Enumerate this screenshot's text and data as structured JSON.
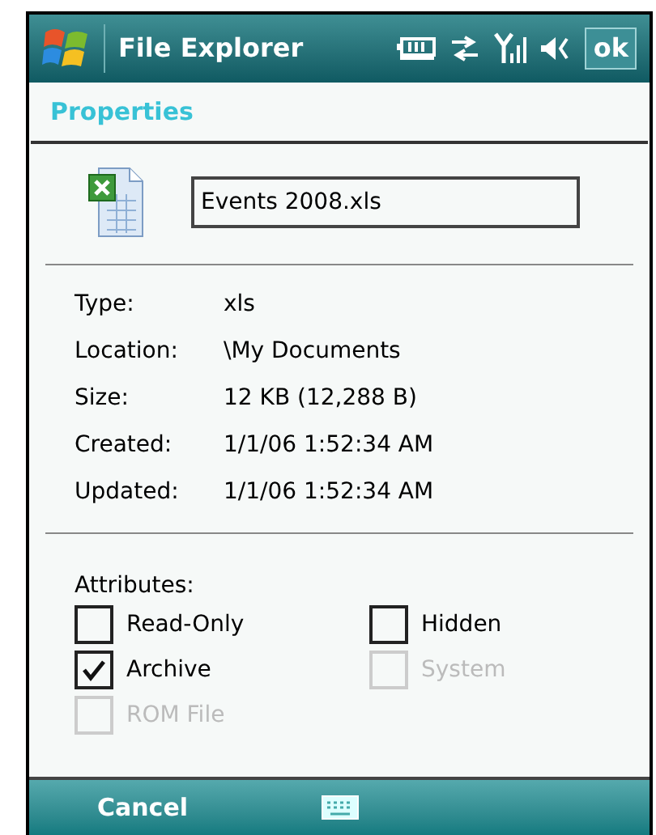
{
  "title_bar": {
    "title": "File Explorer",
    "ok": "ok"
  },
  "header": "Properties",
  "file_name": "Events 2008.xls",
  "details": [
    {
      "label": "Type:",
      "value": "xls"
    },
    {
      "label": "Location:",
      "value": "\\My Documents"
    },
    {
      "label": "Size:",
      "value": "12 KB (12,288 B)"
    },
    {
      "label": "Created:",
      "value": "1/1/06 1:52:34 AM"
    },
    {
      "label": "Updated:",
      "value": "1/1/06 1:52:34 AM"
    }
  ],
  "attributes_label": "Attributes:",
  "attributes": [
    {
      "label": "Read-Only",
      "checked": false,
      "disabled": false
    },
    {
      "label": "Hidden",
      "checked": false,
      "disabled": false
    },
    {
      "label": "Archive",
      "checked": true,
      "disabled": false
    },
    {
      "label": "System",
      "checked": false,
      "disabled": true
    },
    {
      "label": "ROM File",
      "checked": false,
      "disabled": true
    }
  ],
  "soft_keys": {
    "left": "Cancel"
  }
}
